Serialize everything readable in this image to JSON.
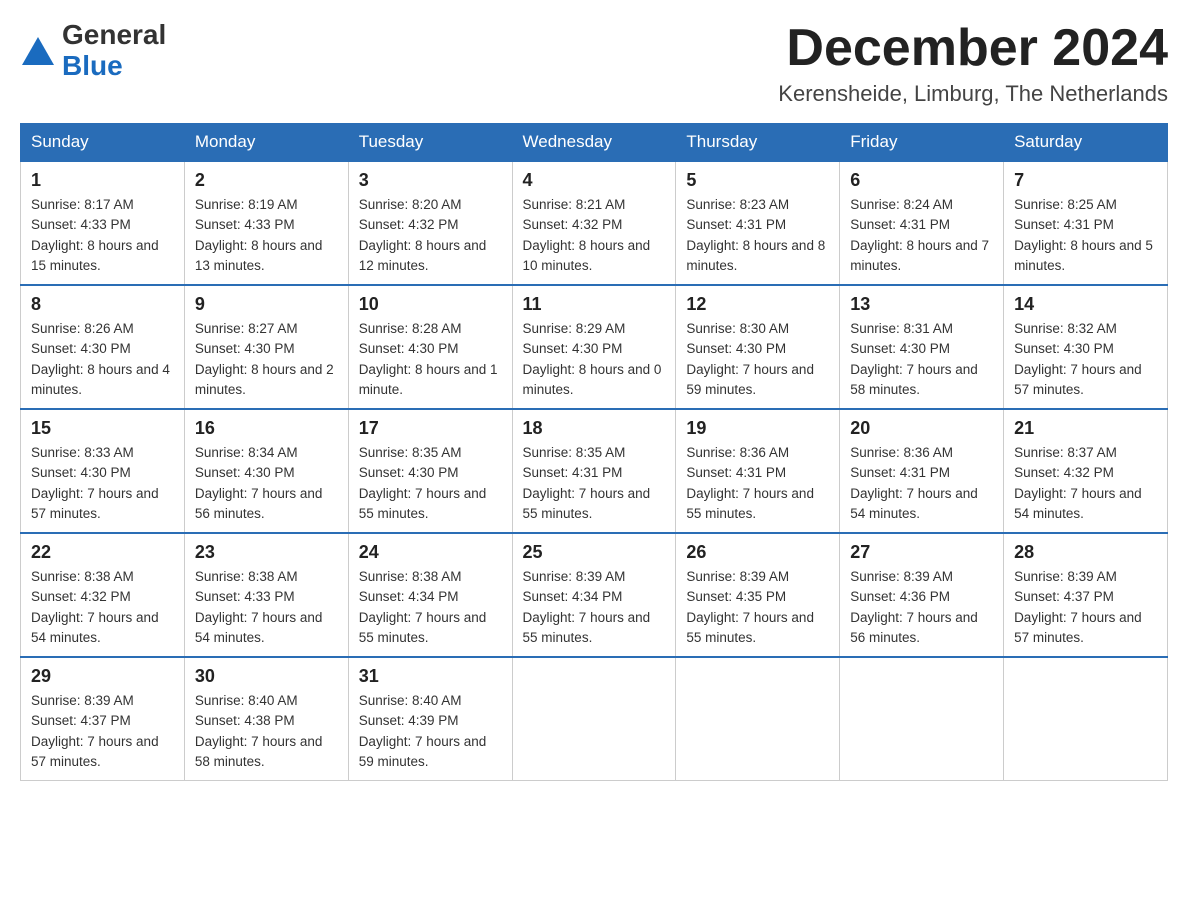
{
  "header": {
    "logo_general": "General",
    "logo_blue": "Blue",
    "month_title": "December 2024",
    "location": "Kerensheide, Limburg, The Netherlands"
  },
  "weekdays": [
    "Sunday",
    "Monday",
    "Tuesday",
    "Wednesday",
    "Thursday",
    "Friday",
    "Saturday"
  ],
  "weeks": [
    [
      {
        "day": "1",
        "sunrise": "8:17 AM",
        "sunset": "4:33 PM",
        "daylight": "8 hours and 15 minutes."
      },
      {
        "day": "2",
        "sunrise": "8:19 AM",
        "sunset": "4:33 PM",
        "daylight": "8 hours and 13 minutes."
      },
      {
        "day": "3",
        "sunrise": "8:20 AM",
        "sunset": "4:32 PM",
        "daylight": "8 hours and 12 minutes."
      },
      {
        "day": "4",
        "sunrise": "8:21 AM",
        "sunset": "4:32 PM",
        "daylight": "8 hours and 10 minutes."
      },
      {
        "day": "5",
        "sunrise": "8:23 AM",
        "sunset": "4:31 PM",
        "daylight": "8 hours and 8 minutes."
      },
      {
        "day": "6",
        "sunrise": "8:24 AM",
        "sunset": "4:31 PM",
        "daylight": "8 hours and 7 minutes."
      },
      {
        "day": "7",
        "sunrise": "8:25 AM",
        "sunset": "4:31 PM",
        "daylight": "8 hours and 5 minutes."
      }
    ],
    [
      {
        "day": "8",
        "sunrise": "8:26 AM",
        "sunset": "4:30 PM",
        "daylight": "8 hours and 4 minutes."
      },
      {
        "day": "9",
        "sunrise": "8:27 AM",
        "sunset": "4:30 PM",
        "daylight": "8 hours and 2 minutes."
      },
      {
        "day": "10",
        "sunrise": "8:28 AM",
        "sunset": "4:30 PM",
        "daylight": "8 hours and 1 minute."
      },
      {
        "day": "11",
        "sunrise": "8:29 AM",
        "sunset": "4:30 PM",
        "daylight": "8 hours and 0 minutes."
      },
      {
        "day": "12",
        "sunrise": "8:30 AM",
        "sunset": "4:30 PM",
        "daylight": "7 hours and 59 minutes."
      },
      {
        "day": "13",
        "sunrise": "8:31 AM",
        "sunset": "4:30 PM",
        "daylight": "7 hours and 58 minutes."
      },
      {
        "day": "14",
        "sunrise": "8:32 AM",
        "sunset": "4:30 PM",
        "daylight": "7 hours and 57 minutes."
      }
    ],
    [
      {
        "day": "15",
        "sunrise": "8:33 AM",
        "sunset": "4:30 PM",
        "daylight": "7 hours and 57 minutes."
      },
      {
        "day": "16",
        "sunrise": "8:34 AM",
        "sunset": "4:30 PM",
        "daylight": "7 hours and 56 minutes."
      },
      {
        "day": "17",
        "sunrise": "8:35 AM",
        "sunset": "4:30 PM",
        "daylight": "7 hours and 55 minutes."
      },
      {
        "day": "18",
        "sunrise": "8:35 AM",
        "sunset": "4:31 PM",
        "daylight": "7 hours and 55 minutes."
      },
      {
        "day": "19",
        "sunrise": "8:36 AM",
        "sunset": "4:31 PM",
        "daylight": "7 hours and 55 minutes."
      },
      {
        "day": "20",
        "sunrise": "8:36 AM",
        "sunset": "4:31 PM",
        "daylight": "7 hours and 54 minutes."
      },
      {
        "day": "21",
        "sunrise": "8:37 AM",
        "sunset": "4:32 PM",
        "daylight": "7 hours and 54 minutes."
      }
    ],
    [
      {
        "day": "22",
        "sunrise": "8:38 AM",
        "sunset": "4:32 PM",
        "daylight": "7 hours and 54 minutes."
      },
      {
        "day": "23",
        "sunrise": "8:38 AM",
        "sunset": "4:33 PM",
        "daylight": "7 hours and 54 minutes."
      },
      {
        "day": "24",
        "sunrise": "8:38 AM",
        "sunset": "4:34 PM",
        "daylight": "7 hours and 55 minutes."
      },
      {
        "day": "25",
        "sunrise": "8:39 AM",
        "sunset": "4:34 PM",
        "daylight": "7 hours and 55 minutes."
      },
      {
        "day": "26",
        "sunrise": "8:39 AM",
        "sunset": "4:35 PM",
        "daylight": "7 hours and 55 minutes."
      },
      {
        "day": "27",
        "sunrise": "8:39 AM",
        "sunset": "4:36 PM",
        "daylight": "7 hours and 56 minutes."
      },
      {
        "day": "28",
        "sunrise": "8:39 AM",
        "sunset": "4:37 PM",
        "daylight": "7 hours and 57 minutes."
      }
    ],
    [
      {
        "day": "29",
        "sunrise": "8:39 AM",
        "sunset": "4:37 PM",
        "daylight": "7 hours and 57 minutes."
      },
      {
        "day": "30",
        "sunrise": "8:40 AM",
        "sunset": "4:38 PM",
        "daylight": "7 hours and 58 minutes."
      },
      {
        "day": "31",
        "sunrise": "8:40 AM",
        "sunset": "4:39 PM",
        "daylight": "7 hours and 59 minutes."
      },
      null,
      null,
      null,
      null
    ]
  ]
}
